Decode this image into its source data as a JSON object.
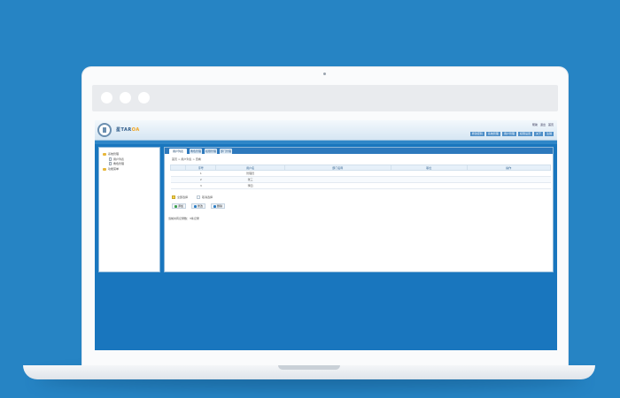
{
  "app": {
    "brand_main": "星TAR",
    "brand_accent": "OA",
    "top_links": [
      "帮助",
      "退出",
      "首页"
    ],
    "menu_items": [
      "修改密码",
      "系统管理",
      "用户管理",
      "权限设置",
      "关于",
      "注销"
    ]
  },
  "sidebar": {
    "items": [
      {
        "label": "系统管理",
        "icon": "folder-icon",
        "level": 0
      },
      {
        "label": "用户列表",
        "icon": "page-icon",
        "level": 1
      },
      {
        "label": "角色管理",
        "icon": "page-icon",
        "level": 1
      },
      {
        "label": "功能菜单",
        "icon": "folder-icon",
        "level": 0
      }
    ]
  },
  "tabs": [
    {
      "label": "用户列表",
      "active": true
    },
    {
      "label": "角色管理",
      "active": false
    },
    {
      "label": "权限管理",
      "active": false
    },
    {
      "label": "部门管理",
      "active": false
    }
  ],
  "breadcrumb": "首页 > 用户列表 > 查看",
  "table": {
    "headers": [
      "",
      "序号",
      "用户名",
      "部门名称",
      "职位",
      "操作"
    ],
    "rows": [
      [
        "",
        "1",
        "管理员",
        "",
        "",
        ""
      ],
      [
        "",
        "2",
        "张三",
        "",
        "",
        ""
      ],
      [
        "",
        "3",
        "李四",
        "",
        "",
        ""
      ]
    ]
  },
  "checkboxes": [
    {
      "label": "全部选择",
      "checked": true
    },
    {
      "label": "取消选择",
      "checked": false
    }
  ],
  "buttons": [
    {
      "label": "添加",
      "color": "#3aa04a"
    },
    {
      "label": "修改",
      "color": "#2c7ec4"
    },
    {
      "label": "删除",
      "color": "#2c7ec4"
    }
  ],
  "footer_note": "当前共有记录数：3条记录"
}
